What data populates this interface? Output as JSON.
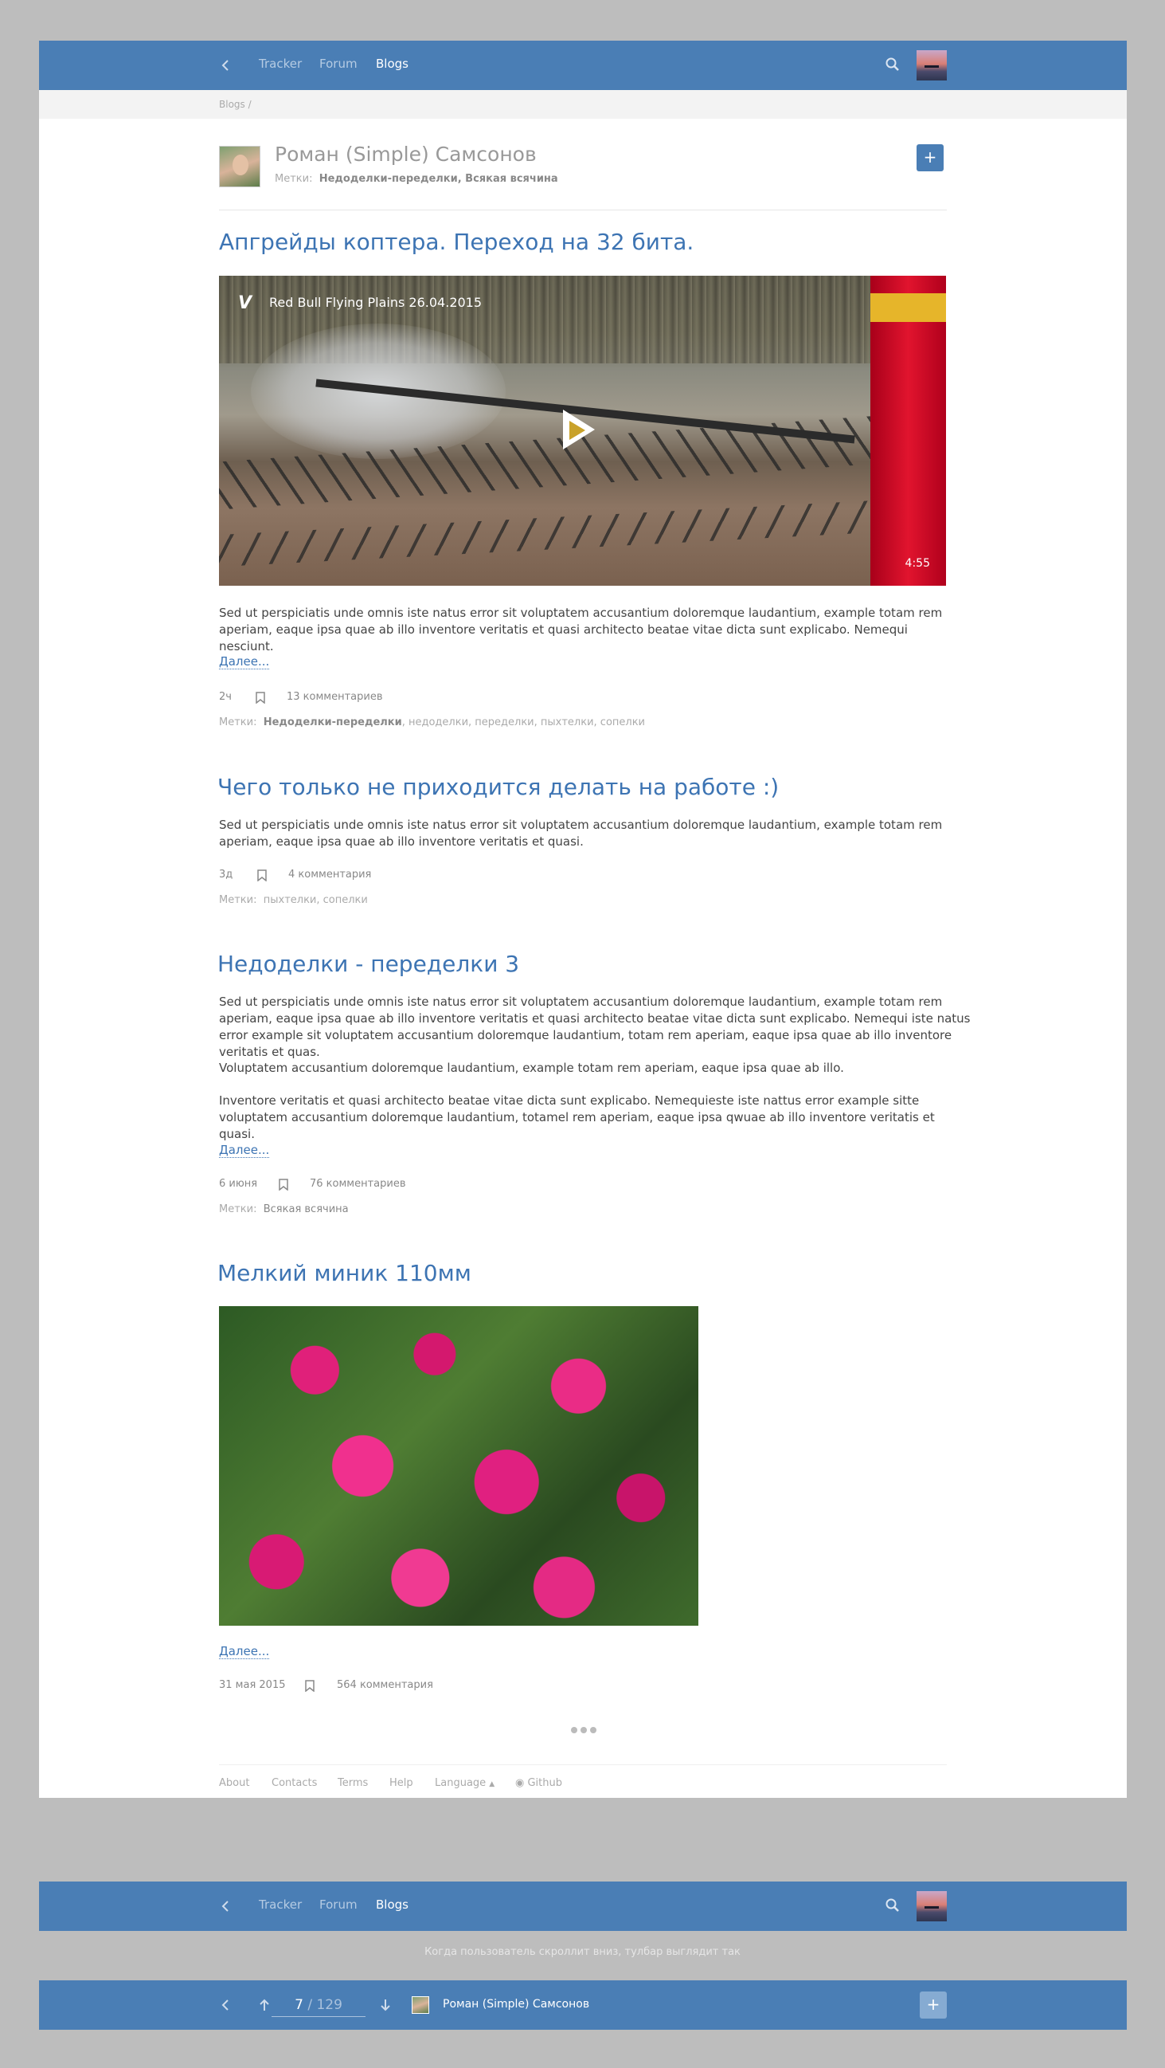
{
  "nav": {
    "tracker": "Tracker",
    "forum": "Forum",
    "blogs": "Blogs"
  },
  "breadcrumb": "Blogs  /",
  "author": {
    "name": "Роман (Simple) Самсонов",
    "tags_label": "Метки:",
    "tags": "Недоделки-переделки, Всякая всячина",
    "add_label": "+"
  },
  "posts": [
    {
      "title": "Апгрейды коптера. Переход на 32 бита.",
      "video": {
        "title": "Red Bull Flying Plains 26.04.2015",
        "duration": "4:55",
        "provider": "V"
      },
      "text": "Sed ut perspiciatis unde omnis iste natus error sit voluptatem accusantium doloremque laudantium, example totam rem aperiam, eaque ipsa quae ab illo inventore veritatis et quasi architecto beatae vitae dicta sunt explicabo. Nemequi nesciunt.",
      "more": "Далее...",
      "time": "2ч",
      "comments": "13 комментариев",
      "tags_label": "Метки:",
      "tag_main": "Недоделки-переделки",
      "tag_rest": ", недоделки, переделки, пыхтелки, сопелки"
    },
    {
      "title": "Чего только не приходится делать на работе :)",
      "text": "Sed ut perspiciatis unde omnis iste natus error sit voluptatem accusantium doloremque laudantium, example totam rem aperiam, eaque ipsa quae ab illo inventore veritatis et quasi.",
      "time": "3д",
      "comments": "4 комментария",
      "tags_label": "Метки:",
      "tag_rest": "пыхтелки, сопелки"
    },
    {
      "title": "Недоделки - переделки 3",
      "text1": "Sed ut perspiciatis unde omnis iste natus error sit voluptatem accusantium doloremque laudantium, example totam rem aperiam, eaque ipsa quae ab illo inventore veritatis et quasi architecto beatae vitae dicta sunt explicabo. Nemequi iste natus error example sit voluptatem accusantium doloremque laudantium,  totam rem aperiam, eaque ipsa quae ab illo inventore veritatis et quas.",
      "text2": "Voluptatem accusantium doloremque laudantium, example totam rem aperiam, eaque ipsa quae ab illo.",
      "text3": "Inventore veritatis et quasi architecto beatae vitae dicta sunt explicabo. Nemequieste iste nattus error example sitte voluptatem accusantium doloremque laudantium,  totamel rem aperiam, eaque ipsa qwuae ab illo inventore veritatis et quasi.",
      "more": "Далее...",
      "time": "6 июня",
      "comments": "76 комментариев",
      "tags_label": "Метки:",
      "tag_dark": "Всякая всячина"
    },
    {
      "title": "Мелкий миник 110мм",
      "more": "Далее...",
      "time": "31 мая 2015",
      "comments": "564 комментария"
    }
  ],
  "footer": {
    "about": "About",
    "contacts": "Contacts",
    "terms": "Terms",
    "help": "Help",
    "language": "Language",
    "github": "Github"
  },
  "caption": "Когда пользователь скроллит вниз, тулбар выглядит так",
  "scroll_bar": {
    "page_current": "7",
    "page_total": " / 129",
    "author_name": "Роман (Simple) Самсонов",
    "add_label": "+"
  },
  "colors": {
    "accent": "#4a7eb5",
    "link": "#3d74b3",
    "background": "#bdbdbd"
  }
}
